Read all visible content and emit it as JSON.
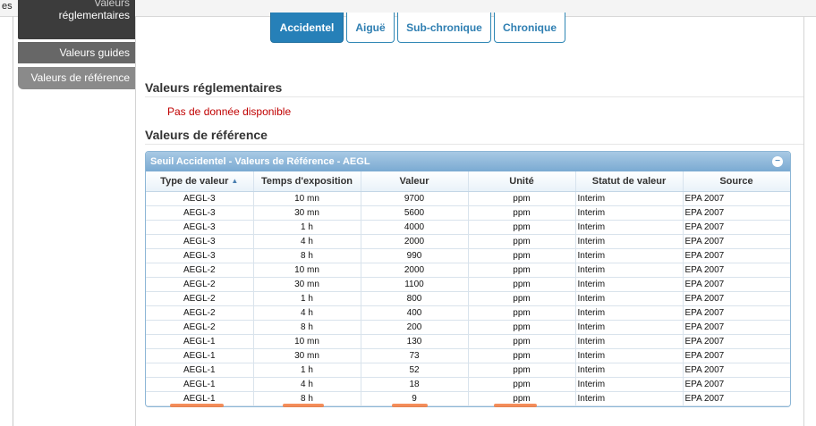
{
  "topbar": {
    "text": "es"
  },
  "sidebar": {
    "items": [
      {
        "line1": "Valeurs",
        "line2": "réglementaires"
      },
      {
        "label": "Valeurs guides"
      },
      {
        "label": "Valeurs de référence"
      }
    ]
  },
  "tabs": [
    {
      "label": "Accidentel",
      "active": true
    },
    {
      "label": "Aiguë"
    },
    {
      "label": "Sub-chronique"
    },
    {
      "label": "Chronique"
    }
  ],
  "sections": {
    "reglementaires": {
      "title": "Valeurs réglementaires",
      "message": "Pas de donnée disponible"
    },
    "reference": {
      "title": "Valeurs de référence"
    }
  },
  "panel": {
    "title": "Seuil Accidentel - Valeurs de Référence - AEGL",
    "collapse_icon": "−",
    "sort_icon": "▲",
    "columns": [
      "Type de valeur",
      "Temps d'exposition",
      "Valeur",
      "Unité",
      "Statut de valeur",
      "Source"
    ],
    "rows": [
      [
        "AEGL-3",
        "10 mn",
        "9700",
        "ppm",
        "Interim",
        "EPA 2007"
      ],
      [
        "AEGL-3",
        "30 mn",
        "5600",
        "ppm",
        "Interim",
        "EPA 2007"
      ],
      [
        "AEGL-3",
        "1 h",
        "4000",
        "ppm",
        "Interim",
        "EPA 2007"
      ],
      [
        "AEGL-3",
        "4 h",
        "2000",
        "ppm",
        "Interim",
        "EPA 2007"
      ],
      [
        "AEGL-3",
        "8 h",
        "990",
        "ppm",
        "Interim",
        "EPA 2007"
      ],
      [
        "AEGL-2",
        "10 mn",
        "2000",
        "ppm",
        "Interim",
        "EPA 2007"
      ],
      [
        "AEGL-2",
        "30 mn",
        "1100",
        "ppm",
        "Interim",
        "EPA 2007"
      ],
      [
        "AEGL-2",
        "1 h",
        "800",
        "ppm",
        "Interim",
        "EPA 2007"
      ],
      [
        "AEGL-2",
        "4 h",
        "400",
        "ppm",
        "Interim",
        "EPA 2007"
      ],
      [
        "AEGL-2",
        "8 h",
        "200",
        "ppm",
        "Interim",
        "EPA 2007"
      ],
      [
        "AEGL-1",
        "10 mn",
        "130",
        "ppm",
        "Interim",
        "EPA 2007"
      ],
      [
        "AEGL-1",
        "30 mn",
        "73",
        "ppm",
        "Interim",
        "EPA 2007"
      ],
      [
        "AEGL-1",
        "1 h",
        "52",
        "ppm",
        "Interim",
        "EPA 2007"
      ],
      [
        "AEGL-1",
        "4 h",
        "18",
        "ppm",
        "Interim",
        "EPA 2007"
      ],
      [
        "AEGL-1",
        "8 h",
        "9",
        "ppm",
        "Interim",
        "EPA 2007"
      ]
    ]
  },
  "colors": {
    "accent": "#2680b8",
    "panel_header": "#7aaad2",
    "error": "#c00000",
    "annotation": "#f37a3d"
  }
}
